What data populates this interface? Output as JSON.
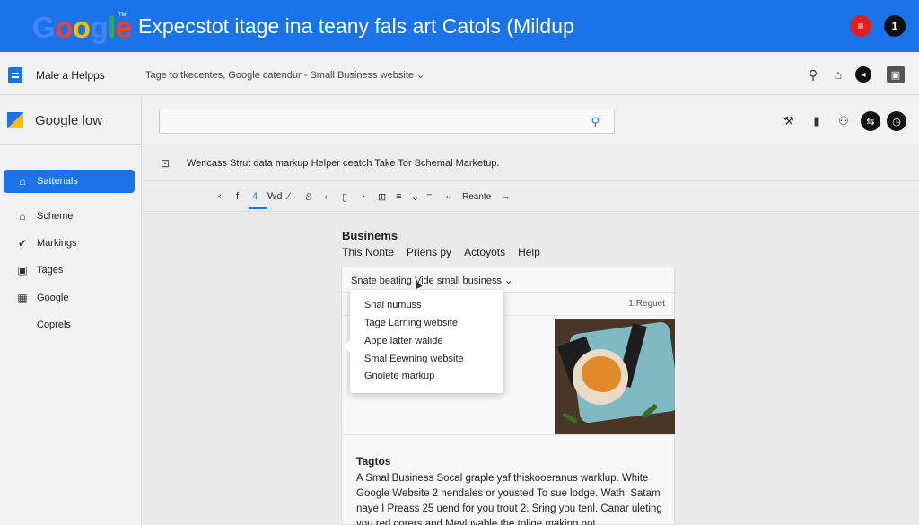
{
  "banner": {
    "logo_letters": [
      "G",
      "o",
      "o",
      "g",
      "l",
      "e"
    ],
    "logo_colors": [
      "#4285f4",
      "#ea4335",
      "#fbbc05",
      "#4285f4",
      "#34a853",
      "#ea4335"
    ],
    "logo_tm": "TM",
    "title": "Expecstot itage ina teany fals art Catols (Mildup",
    "badge_count": "1"
  },
  "topbar": {
    "app_name": "Male a Helpps",
    "breadcrumb": "Tage to tkecentes, Google catendur - Small Business website ⌄"
  },
  "sidebar": {
    "brand": "Google low",
    "items": [
      {
        "label": "Sattenals",
        "icon": "home-icon",
        "glyph": "⌂"
      },
      {
        "label": "Scheme",
        "icon": "home-icon",
        "glyph": "⌂"
      },
      {
        "label": "Markings",
        "icon": "check-icon",
        "glyph": "✔"
      },
      {
        "label": "Tages",
        "icon": "tag-icon",
        "glyph": "▣"
      },
      {
        "label": "Google",
        "icon": "table-icon",
        "glyph": "▦"
      },
      {
        "label": "Coprels",
        "icon": "",
        "glyph": ""
      }
    ]
  },
  "info": {
    "text": "Werlcass Strut data markup Helper ceatch Take Tor Schemal Marketup."
  },
  "toolbar": {
    "items": [
      "‹",
      "f",
      "4",
      "Wd",
      "⁄",
      "ℰ",
      "⌁",
      "▯",
      "›",
      "⊞",
      "≡",
      "⌄",
      "=",
      "⌁",
      "Reante",
      "→"
    ]
  },
  "editor": {
    "title": "Businems",
    "menu": [
      "This Nonte",
      "Priens py",
      "Actoyots",
      "Help"
    ],
    "card_header": "Snate   beating   Vide   small business  ⌄",
    "card_sub_right": "1 Reguet",
    "section_title": "Tagtos",
    "body_lines": [
      "A Smal Business Socal graple yaf thiskooeranus warklup. White",
      "Google Website 2 nendales or yousted To sue lodge. Wath: Satam",
      "naye I Preass 25 uend for you trout 2. Sring you tenl. Canar uleting",
      "you red corers and Mevluvable the tolige making not"
    ]
  },
  "dropdown": {
    "items": [
      "Snal numuss",
      "Tage Larning website",
      "Appe latter walide",
      "Smal Eewning website",
      "Gnolete markup"
    ]
  }
}
